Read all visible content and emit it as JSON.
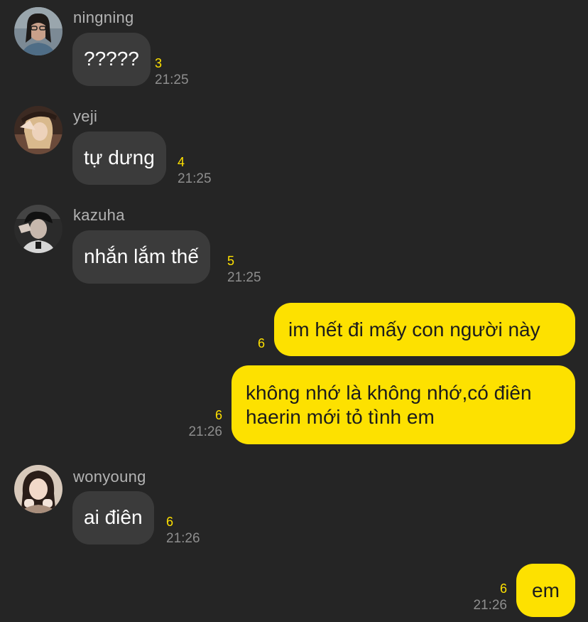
{
  "messages": [
    {
      "sender": "ningning",
      "text": "?????",
      "unread": "3",
      "time": "21:25"
    },
    {
      "sender": "yeji",
      "text": "tự dưng",
      "unread": "4",
      "time": "21:25"
    },
    {
      "sender": "kazuha",
      "text": "nhắn lắm thế",
      "unread": "5",
      "time": "21:25"
    },
    {
      "text": "im hết đi mấy con người này",
      "unread": "6"
    },
    {
      "lines": [
        "không nhớ là không nhớ,có điên",
        "haerin mới tỏ tình em"
      ],
      "unread": "6",
      "time": "21:26"
    },
    {
      "sender": "wonyoung",
      "text": "ai điên",
      "unread": "6",
      "time": "21:26"
    },
    {
      "text": "em",
      "unread": "6",
      "time": "21:26"
    }
  ],
  "colors": {
    "background": "#252525",
    "incoming_bubble": "#3b3b3b",
    "outgoing_bubble": "#fde100",
    "unread_count": "#ffe100",
    "timestamp": "#8e8e8e"
  }
}
